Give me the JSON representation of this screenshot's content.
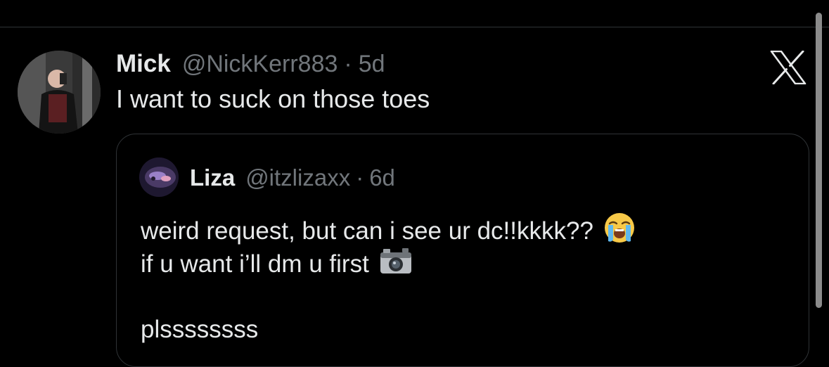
{
  "tweet": {
    "author_name": "Mick",
    "author_handle": "@NickKerr883",
    "separator": "·",
    "time": "5d",
    "text": "I want to suck on those toes"
  },
  "quoted_tweet": {
    "author_name": "Liza",
    "author_handle": "@itzlizaxx",
    "separator": "·",
    "time": "6d",
    "lines": [
      "weird request, but can i see ur dc!!kkkk??",
      "if u want i’ll dm u first",
      "plssssssss"
    ],
    "emojis": [
      "loudly-crying-face-emoji",
      "camera-with-flash-emoji"
    ]
  },
  "icons": {
    "brand": "x-logo-icon"
  },
  "colors": {
    "background": "#000000",
    "primary_text": "#e7e9ea",
    "secondary_text": "#71767b",
    "border": "#2f3336"
  }
}
